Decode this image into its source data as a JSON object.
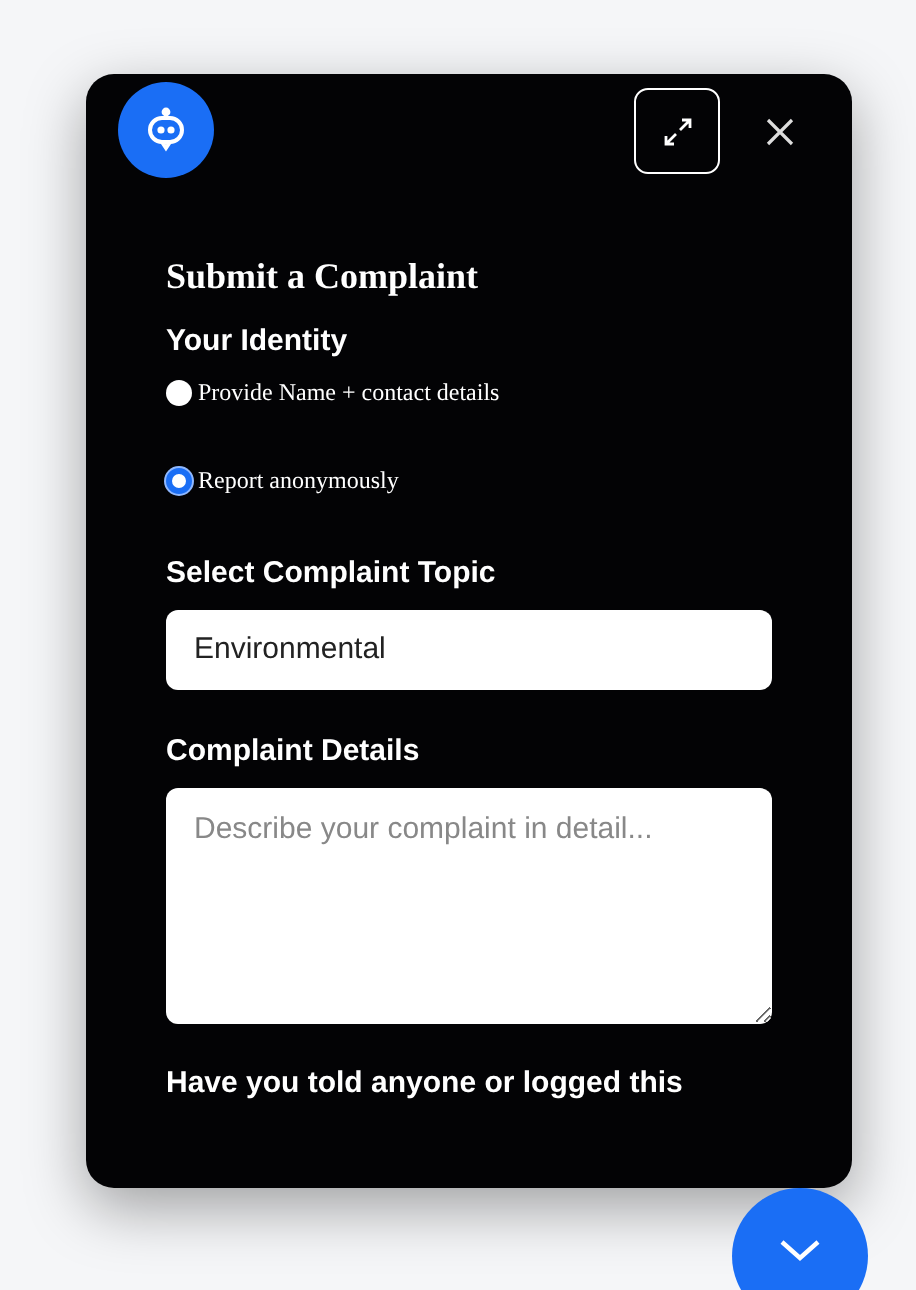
{
  "form": {
    "title": "Submit a Complaint",
    "identity": {
      "label": "Your Identity",
      "options": [
        {
          "label": "Provide Name + contact details",
          "selected": false
        },
        {
          "label": "Report anonymously",
          "selected": true
        }
      ]
    },
    "topic": {
      "label": "Select Complaint Topic",
      "value": "Environmental"
    },
    "details": {
      "label": "Complaint Details",
      "placeholder": "Describe your complaint in detail..."
    },
    "question": {
      "label": "Have you told anyone or logged this"
    }
  }
}
